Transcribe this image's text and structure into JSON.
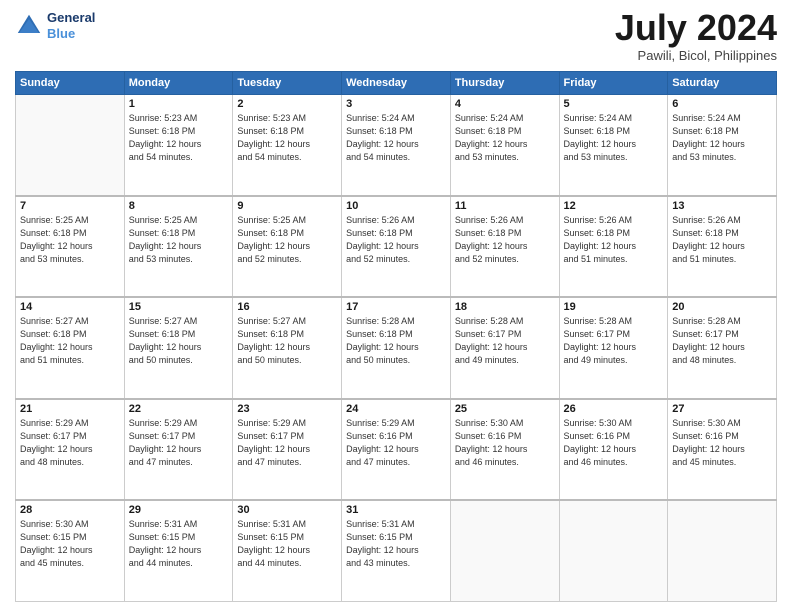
{
  "logo": {
    "line1": "General",
    "line2": "Blue"
  },
  "title": "July 2024",
  "location": "Pawili, Bicol, Philippines",
  "weekdays": [
    "Sunday",
    "Monday",
    "Tuesday",
    "Wednesday",
    "Thursday",
    "Friday",
    "Saturday"
  ],
  "weeks": [
    [
      {
        "day": "",
        "info": ""
      },
      {
        "day": "1",
        "info": "Sunrise: 5:23 AM\nSunset: 6:18 PM\nDaylight: 12 hours\nand 54 minutes."
      },
      {
        "day": "2",
        "info": "Sunrise: 5:23 AM\nSunset: 6:18 PM\nDaylight: 12 hours\nand 54 minutes."
      },
      {
        "day": "3",
        "info": "Sunrise: 5:24 AM\nSunset: 6:18 PM\nDaylight: 12 hours\nand 54 minutes."
      },
      {
        "day": "4",
        "info": "Sunrise: 5:24 AM\nSunset: 6:18 PM\nDaylight: 12 hours\nand 53 minutes."
      },
      {
        "day": "5",
        "info": "Sunrise: 5:24 AM\nSunset: 6:18 PM\nDaylight: 12 hours\nand 53 minutes."
      },
      {
        "day": "6",
        "info": "Sunrise: 5:24 AM\nSunset: 6:18 PM\nDaylight: 12 hours\nand 53 minutes."
      }
    ],
    [
      {
        "day": "7",
        "info": "Sunrise: 5:25 AM\nSunset: 6:18 PM\nDaylight: 12 hours\nand 53 minutes."
      },
      {
        "day": "8",
        "info": "Sunrise: 5:25 AM\nSunset: 6:18 PM\nDaylight: 12 hours\nand 53 minutes."
      },
      {
        "day": "9",
        "info": "Sunrise: 5:25 AM\nSunset: 6:18 PM\nDaylight: 12 hours\nand 52 minutes."
      },
      {
        "day": "10",
        "info": "Sunrise: 5:26 AM\nSunset: 6:18 PM\nDaylight: 12 hours\nand 52 minutes."
      },
      {
        "day": "11",
        "info": "Sunrise: 5:26 AM\nSunset: 6:18 PM\nDaylight: 12 hours\nand 52 minutes."
      },
      {
        "day": "12",
        "info": "Sunrise: 5:26 AM\nSunset: 6:18 PM\nDaylight: 12 hours\nand 51 minutes."
      },
      {
        "day": "13",
        "info": "Sunrise: 5:26 AM\nSunset: 6:18 PM\nDaylight: 12 hours\nand 51 minutes."
      }
    ],
    [
      {
        "day": "14",
        "info": "Sunrise: 5:27 AM\nSunset: 6:18 PM\nDaylight: 12 hours\nand 51 minutes."
      },
      {
        "day": "15",
        "info": "Sunrise: 5:27 AM\nSunset: 6:18 PM\nDaylight: 12 hours\nand 50 minutes."
      },
      {
        "day": "16",
        "info": "Sunrise: 5:27 AM\nSunset: 6:18 PM\nDaylight: 12 hours\nand 50 minutes."
      },
      {
        "day": "17",
        "info": "Sunrise: 5:28 AM\nSunset: 6:18 PM\nDaylight: 12 hours\nand 50 minutes."
      },
      {
        "day": "18",
        "info": "Sunrise: 5:28 AM\nSunset: 6:17 PM\nDaylight: 12 hours\nand 49 minutes."
      },
      {
        "day": "19",
        "info": "Sunrise: 5:28 AM\nSunset: 6:17 PM\nDaylight: 12 hours\nand 49 minutes."
      },
      {
        "day": "20",
        "info": "Sunrise: 5:28 AM\nSunset: 6:17 PM\nDaylight: 12 hours\nand 48 minutes."
      }
    ],
    [
      {
        "day": "21",
        "info": "Sunrise: 5:29 AM\nSunset: 6:17 PM\nDaylight: 12 hours\nand 48 minutes."
      },
      {
        "day": "22",
        "info": "Sunrise: 5:29 AM\nSunset: 6:17 PM\nDaylight: 12 hours\nand 47 minutes."
      },
      {
        "day": "23",
        "info": "Sunrise: 5:29 AM\nSunset: 6:17 PM\nDaylight: 12 hours\nand 47 minutes."
      },
      {
        "day": "24",
        "info": "Sunrise: 5:29 AM\nSunset: 6:16 PM\nDaylight: 12 hours\nand 47 minutes."
      },
      {
        "day": "25",
        "info": "Sunrise: 5:30 AM\nSunset: 6:16 PM\nDaylight: 12 hours\nand 46 minutes."
      },
      {
        "day": "26",
        "info": "Sunrise: 5:30 AM\nSunset: 6:16 PM\nDaylight: 12 hours\nand 46 minutes."
      },
      {
        "day": "27",
        "info": "Sunrise: 5:30 AM\nSunset: 6:16 PM\nDaylight: 12 hours\nand 45 minutes."
      }
    ],
    [
      {
        "day": "28",
        "info": "Sunrise: 5:30 AM\nSunset: 6:15 PM\nDaylight: 12 hours\nand 45 minutes."
      },
      {
        "day": "29",
        "info": "Sunrise: 5:31 AM\nSunset: 6:15 PM\nDaylight: 12 hours\nand 44 minutes."
      },
      {
        "day": "30",
        "info": "Sunrise: 5:31 AM\nSunset: 6:15 PM\nDaylight: 12 hours\nand 44 minutes."
      },
      {
        "day": "31",
        "info": "Sunrise: 5:31 AM\nSunset: 6:15 PM\nDaylight: 12 hours\nand 43 minutes."
      },
      {
        "day": "",
        "info": ""
      },
      {
        "day": "",
        "info": ""
      },
      {
        "day": "",
        "info": ""
      }
    ]
  ]
}
